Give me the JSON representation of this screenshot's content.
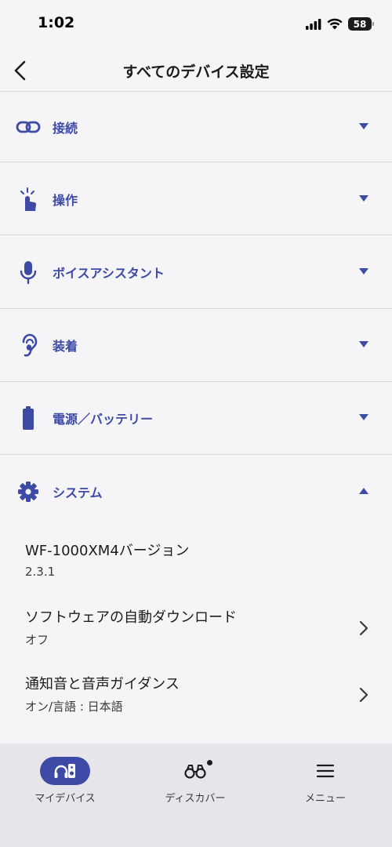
{
  "status_bar": {
    "time": "1:02",
    "battery": "58"
  },
  "header": {
    "title": "すべてのデバイス設定"
  },
  "sections": [
    {
      "label": "接続",
      "icon": "link-icon",
      "expanded": false
    },
    {
      "label": "操作",
      "icon": "touch-icon",
      "expanded": false
    },
    {
      "label": "ボイスアシスタント",
      "icon": "microphone-icon",
      "expanded": false
    },
    {
      "label": "装着",
      "icon": "ear-icon",
      "expanded": false
    },
    {
      "label": "電源／バッテリー",
      "icon": "battery-icon",
      "expanded": false
    },
    {
      "label": "システム",
      "icon": "gear-icon",
      "expanded": true
    }
  ],
  "system_items": [
    {
      "title": "WF-1000XM4バージョン",
      "value": "2.3.1",
      "navigable": false
    },
    {
      "title": "ソフトウェアの自動ダウンロード",
      "value": "オフ",
      "navigable": true
    },
    {
      "title": "通知音と音声ガイダンス",
      "value": "オン/言語 : 日本語",
      "navigable": true
    }
  ],
  "tab_bar": {
    "tabs": [
      {
        "label": "マイデバイス",
        "icon": "headphones-speaker-icon",
        "active": true
      },
      {
        "label": "ディスカバー",
        "icon": "binoculars-icon",
        "active": false
      },
      {
        "label": "メニュー",
        "icon": "hamburger-menu-icon",
        "active": false
      }
    ]
  },
  "colors": {
    "accent": "#3d4aa6",
    "background": "#f5f5f7",
    "tab_bar": "#e6e6ea"
  }
}
